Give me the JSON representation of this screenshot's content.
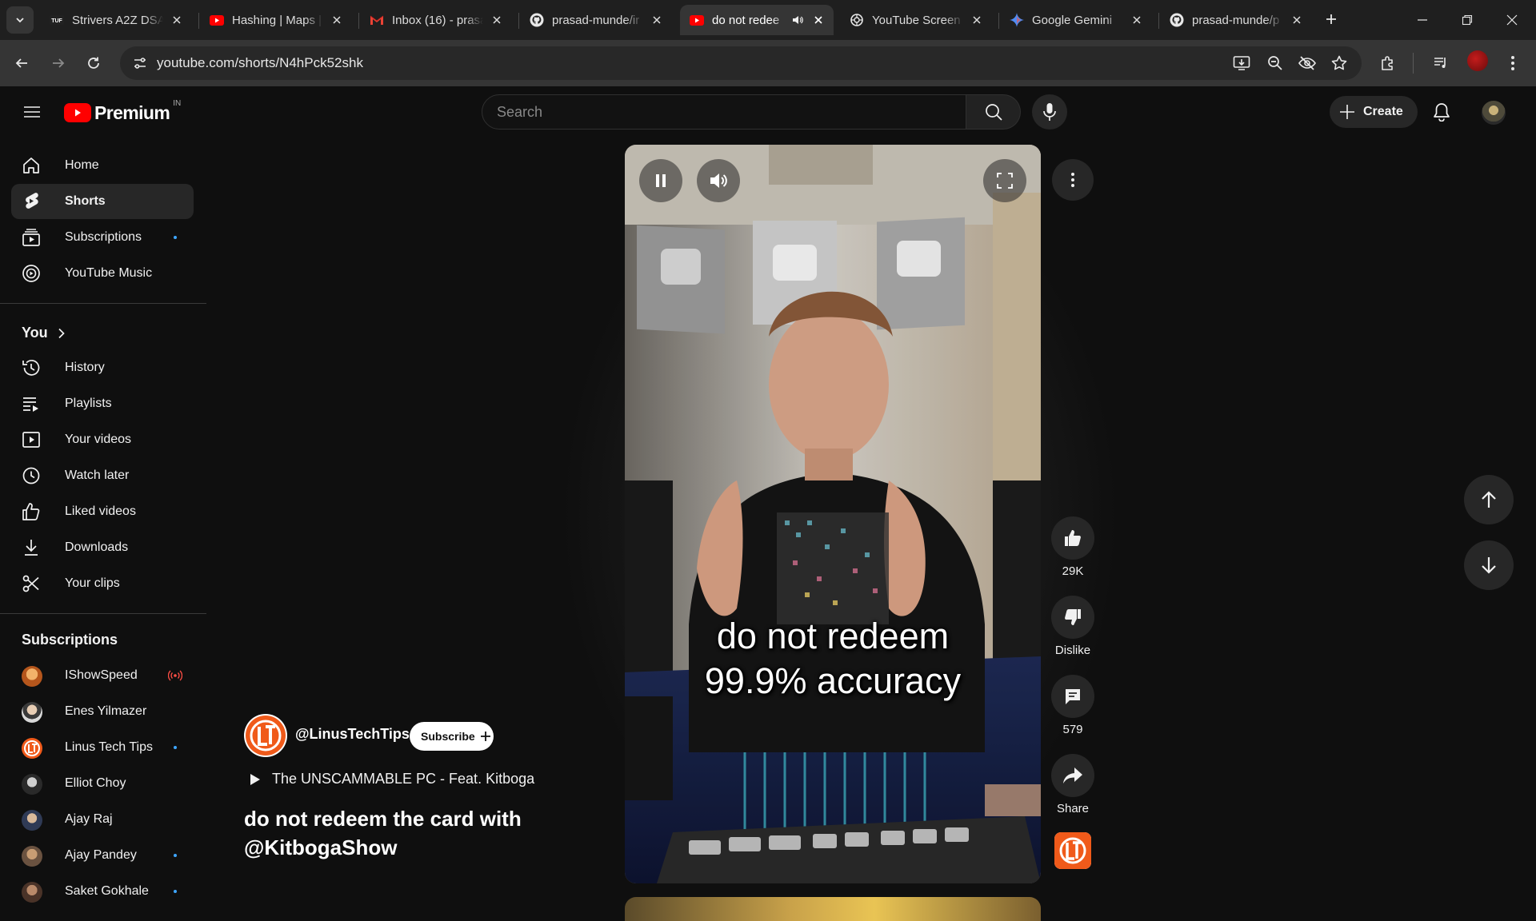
{
  "browser": {
    "tabs": [
      {
        "title": "Strivers A2Z DSA",
        "icon": "tuf-icon"
      },
      {
        "title": "Hashing | Maps |",
        "icon": "youtube-icon"
      },
      {
        "title": "Inbox (16) - prasa",
        "icon": "gmail-icon"
      },
      {
        "title": "prasad-munde/ir",
        "icon": "github-icon"
      },
      {
        "title": "do not redee",
        "icon": "youtube-icon",
        "active": true,
        "audio": true
      },
      {
        "title": "YouTube Screen",
        "icon": "chatgpt-icon"
      },
      {
        "title": "Google Gemini",
        "icon": "gemini-icon"
      },
      {
        "title": "prasad-munde/p",
        "icon": "github-icon"
      }
    ],
    "url": "youtube.com/shorts/N4hPck52shk"
  },
  "masthead": {
    "logo_text": "Premium",
    "country_code": "IN",
    "search_placeholder": "Search",
    "create_label": "Create"
  },
  "sidebar": {
    "main": [
      {
        "label": "Home",
        "icon": "home-icon"
      },
      {
        "label": "Shorts",
        "icon": "shorts-icon",
        "active": true
      },
      {
        "label": "Subscriptions",
        "icon": "subscriptions-icon",
        "dot": true
      },
      {
        "label": "YouTube Music",
        "icon": "youtube-music-icon"
      }
    ],
    "you_title": "You",
    "you": [
      {
        "label": "History",
        "icon": "history-icon"
      },
      {
        "label": "Playlists",
        "icon": "playlists-icon"
      },
      {
        "label": "Your videos",
        "icon": "your-videos-icon"
      },
      {
        "label": "Watch later",
        "icon": "watch-later-icon"
      },
      {
        "label": "Liked videos",
        "icon": "liked-videos-icon"
      },
      {
        "label": "Downloads",
        "icon": "downloads-icon"
      },
      {
        "label": "Your clips",
        "icon": "your-clips-icon"
      }
    ],
    "subscriptions_title": "Subscriptions",
    "subscriptions": [
      {
        "label": "IShowSpeed",
        "live": true,
        "color": "#d98a3a"
      },
      {
        "label": "Enes Yilmazer",
        "color": "#8a8a8a"
      },
      {
        "label": "Linus Tech Tips",
        "dot": true,
        "color": "#f05a1a"
      },
      {
        "label": "Elliot Choy",
        "color": "#4a4a4a"
      },
      {
        "label": "Ajay Raj",
        "color": "#5a6a8a"
      },
      {
        "label": "Ajay Pandey",
        "dot": true,
        "color": "#9a7a5a"
      },
      {
        "label": "Saket Gokhale",
        "dot": true,
        "color": "#7a5a4a"
      }
    ]
  },
  "player": {
    "overlay_line1": "do not redeem",
    "overlay_line2": "99.9% accuracy"
  },
  "meta": {
    "channel": "@LinusTechTips",
    "subscribe_label": "Subscribe",
    "playlist": "The UNSCAMMABLE PC - Feat. Kitboga",
    "title": "do not redeem the card with @KitbogaShow"
  },
  "actions": {
    "like_count": "29K",
    "dislike_label": "Dislike",
    "comment_count": "579",
    "share_label": "Share"
  },
  "colors": {
    "accent_red": "#ff0000",
    "live_red": "#ff4e45",
    "unseen_dot": "#3ea6ff",
    "background": "#0f0f0f"
  }
}
